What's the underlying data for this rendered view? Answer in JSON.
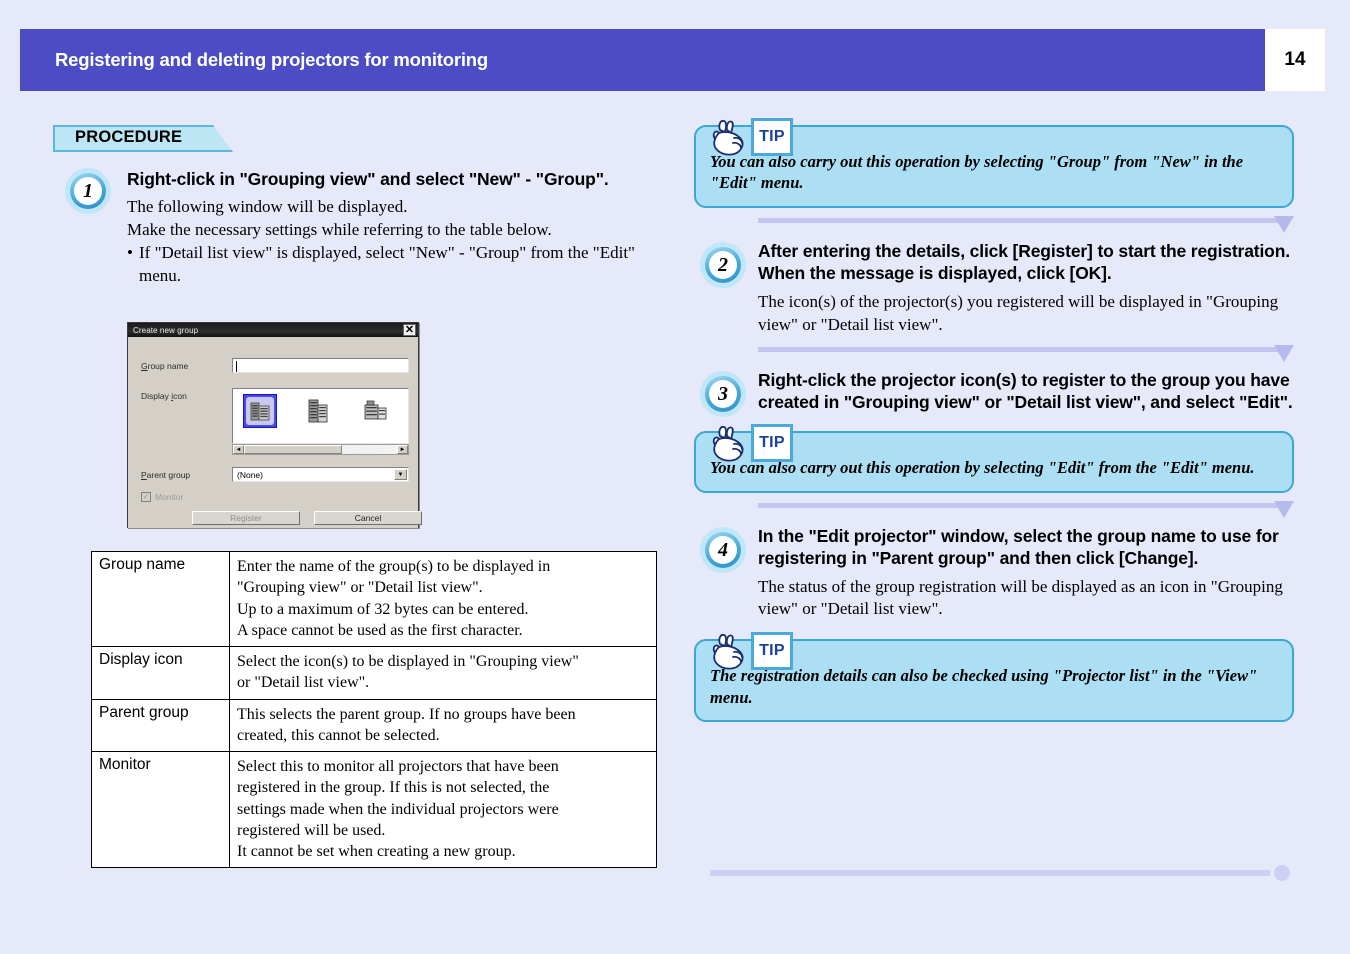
{
  "header": {
    "title": "Registering and deleting projectors for monitoring",
    "page_number": "14",
    "bar_color": "#4c4cc4"
  },
  "left": {
    "procedure_label": "PROCEDURE",
    "step1": {
      "number": "1",
      "title": "Right-click in \"Grouping view\" and select \"New\" - \"Group\".",
      "body_line1": "The following window will be displayed.",
      "body_line2": "Make the necessary settings while referring to the table below.",
      "body_bullet": "If \"Detail list view\" is displayed, select \"New\" - \"Group\" from the \"Edit\" menu."
    }
  },
  "dialog": {
    "title": "Create new group",
    "close_icon": "close-icon",
    "group_name_label": "Group name",
    "group_name_value": "",
    "display_icon_label": "Display icon",
    "icon_options": [
      "building-icon-1",
      "building-icon-2",
      "building-icon-3"
    ],
    "icon_selected_index": 0,
    "parent_group_label": "Parent group",
    "parent_group_value": "(None)",
    "monitor_label": "Monitor",
    "monitor_checked": true,
    "monitor_enabled": false,
    "register_button": "Register",
    "register_enabled": false,
    "cancel_button": "Cancel",
    "scroll_left_arrow": "◄",
    "scroll_right_arrow": "►",
    "dropdown_arrow": "▼"
  },
  "table": {
    "rows": [
      {
        "key": "Group name",
        "lines": [
          "Enter the name of the group(s) to be displayed in",
          "\"Grouping view\" or \"Detail list view\".",
          "Up to a maximum of 32 bytes can be entered.",
          "A space cannot be used as the first character."
        ]
      },
      {
        "key": "Display icon",
        "lines": [
          "Select the icon(s) to be displayed in \"Grouping view\"",
          "or \"Detail list view\"."
        ]
      },
      {
        "key": "Parent group",
        "lines": [
          "This selects the parent group. If no groups have been",
          "created, this cannot be selected."
        ]
      },
      {
        "key": "Monitor",
        "lines": [
          "Select this to monitor all projectors that have been",
          "registered in the group. If this is not selected, the",
          "settings made when the individual projectors were",
          "registered will be used.",
          "It cannot be set when creating a new group."
        ]
      }
    ]
  },
  "right": {
    "tip1": {
      "badge": "TIP",
      "text": "You can also carry out this operation by selecting \"Group\" from \"New\" in the \"Edit\" menu."
    },
    "step2": {
      "number": "2",
      "title": "After entering the details, click [Register] to start the registration. When the message is displayed, click [OK].",
      "body": "The icon(s) of the projector(s) you registered will be displayed in \"Grouping view\" or \"Detail list view\"."
    },
    "step3": {
      "number": "3",
      "title": "Right-click the projector icon(s) to register to the group you have created in \"Grouping view\" or \"Detail list view\", and select \"Edit\"."
    },
    "tip2": {
      "badge": "TIP",
      "text": "You can also carry out this operation by selecting \"Edit\" from the \"Edit\" menu."
    },
    "step4": {
      "number": "4",
      "title": "In the \"Edit projector\" window, select the group name to use for registering in \"Parent group\" and then click [Change].",
      "body": "The status of the group registration will be displayed as an icon in \"Grouping view\" or \"Detail list view\"."
    },
    "tip3": {
      "badge": "TIP",
      "text": "The registration details can also be checked using \"Projector list\" in the \"View\" menu."
    }
  }
}
